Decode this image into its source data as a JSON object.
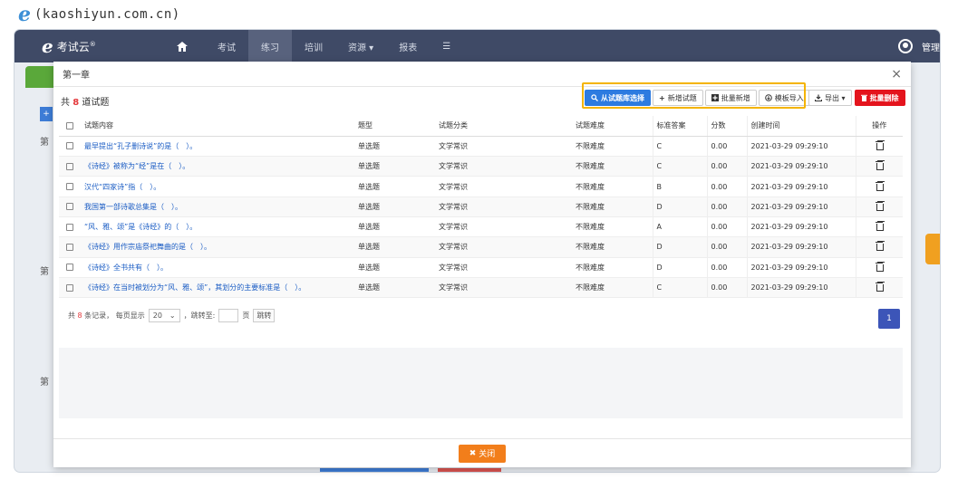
{
  "watermark": {
    "logo": "𝒆",
    "text": "(kaoshiyun.com.cn)"
  },
  "nav": {
    "brand_logo": "e",
    "brand_name": "考试云",
    "brand_sup": "®",
    "items": [
      "考试",
      "练习",
      "培训",
      "资源 ▾",
      "报表",
      "☰"
    ],
    "admin": "管理"
  },
  "background": {
    "side1": "第",
    "side2": "第",
    "side3": "第",
    "add": "+"
  },
  "modal": {
    "title": "第一章",
    "close": "×",
    "total_prefix": "共 ",
    "total_num": "8",
    "total_suffix": " 道试题",
    "buttons": {
      "from_bank": "从试题库选择",
      "add_new": "新增试题",
      "batch_add": "批量新增",
      "template_import": "模板导入",
      "export": "导出 ▾",
      "batch_delete": "批量删除"
    },
    "columns": [
      "试题内容",
      "题型",
      "试题分类",
      "试题难度",
      "标准答案",
      "分数",
      "创建时间",
      "操作"
    ],
    "rows": [
      {
        "content": "最早提出“孔子删诗说”的是（　）。",
        "type": "单选题",
        "category": "文学常识",
        "difficulty": "不限难度",
        "answer": "C",
        "score": "0.00",
        "created": "2021-03-29 09:29:10"
      },
      {
        "content": "《诗经》被称为“经”是在（　）。",
        "type": "单选题",
        "category": "文学常识",
        "difficulty": "不限难度",
        "answer": "C",
        "score": "0.00",
        "created": "2021-03-29 09:29:10"
      },
      {
        "content": "汉代“四家诗”指（　）。",
        "type": "单选题",
        "category": "文学常识",
        "difficulty": "不限难度",
        "answer": "B",
        "score": "0.00",
        "created": "2021-03-29 09:29:10"
      },
      {
        "content": "我国第一部诗歌总集是（　）。",
        "type": "单选题",
        "category": "文学常识",
        "difficulty": "不限难度",
        "answer": "D",
        "score": "0.00",
        "created": "2021-03-29 09:29:10"
      },
      {
        "content": "“风、雅、颂”是《诗经》的（　）。",
        "type": "单选题",
        "category": "文学常识",
        "difficulty": "不限难度",
        "answer": "A",
        "score": "0.00",
        "created": "2021-03-29 09:29:10"
      },
      {
        "content": "《诗经》用作宗庙祭祀舞曲的是（　）。",
        "type": "单选题",
        "category": "文学常识",
        "difficulty": "不限难度",
        "answer": "D",
        "score": "0.00",
        "created": "2021-03-29 09:29:10"
      },
      {
        "content": "《诗经》全书共有（　）。",
        "type": "单选题",
        "category": "文学常识",
        "difficulty": "不限难度",
        "answer": "D",
        "score": "0.00",
        "created": "2021-03-29 09:29:10"
      },
      {
        "content": "《诗经》在当时被划分为“风、雅、颂”，其划分的主要标准是（　）。",
        "type": "单选题",
        "category": "文学常识",
        "difficulty": "不限难度",
        "answer": "C",
        "score": "0.00",
        "created": "2021-03-29 09:29:10"
      }
    ],
    "pager": {
      "prefix": "共 ",
      "count": "8",
      "middle": " 条记录， 每页显示",
      "page_size": "20",
      "jump_label": "，跳转至:",
      "page_unit": "页",
      "jump_btn": "跳转",
      "current_page": "1"
    },
    "footer_close": "关闭"
  },
  "colors": {
    "nav_bg": "#3f4a66",
    "primary": "#2d7be0",
    "danger": "#e4141d",
    "highlight": "#f4b400",
    "close_btn": "#f27e1b",
    "page_badge": "#3c55b8"
  }
}
